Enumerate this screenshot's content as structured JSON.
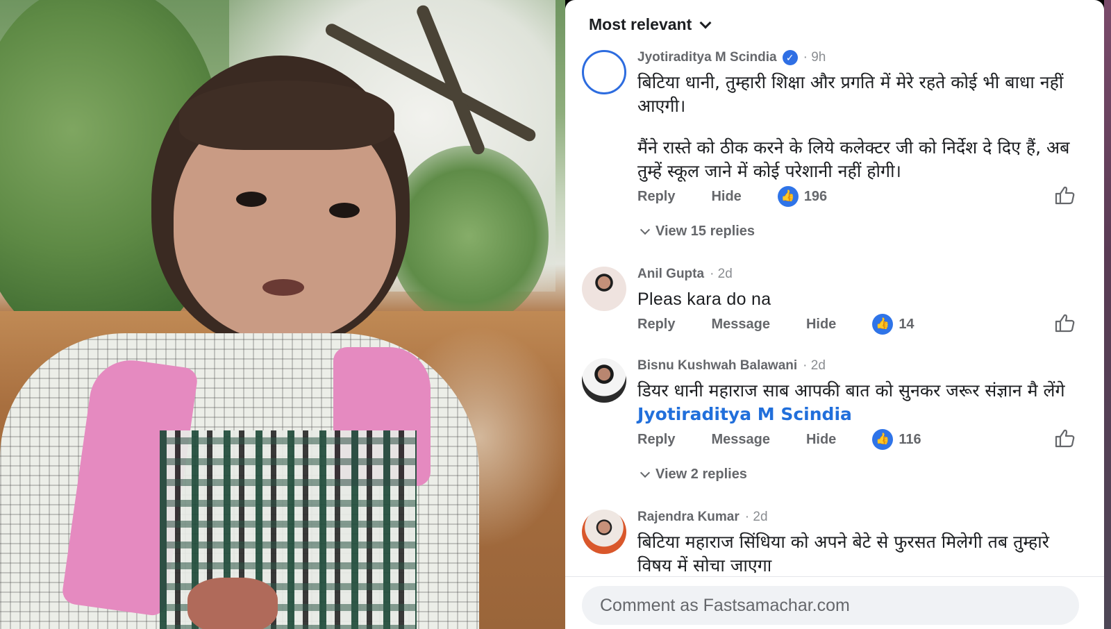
{
  "panel": {
    "sort_label": "Most relevant",
    "composer_placeholder": "Comment as Fastsamachar.com"
  },
  "comments": [
    {
      "name": "Jyotiraditya M Scindia",
      "verified": true,
      "time": "· 9h",
      "text_p1": "बिटिया धानी, तुम्हारी शिक्षा और प्रगति में मेरे रहते कोई भी बाधा नहीं आएगी।",
      "text_p2": "मैंने रास्ते को ठीक करने के लिये कलेक्टर जी को निर्देश दे दिए हैं, अब तुम्हें स्कूल जाने में कोई परेशानी नहीं होगी।",
      "actions": [
        "Reply",
        "Hide"
      ],
      "likes": "196",
      "view_replies": "View 15 replies"
    },
    {
      "name": "Anil Gupta",
      "time": "· 2d",
      "text": "Pleas kara do na",
      "actions": [
        "Reply",
        "Message",
        "Hide"
      ],
      "likes": "14"
    },
    {
      "name": "Bisnu Kushwah Balawani",
      "time": "· 2d",
      "text": "डियर धानी महाराज साब आपकी बात को सुनकर जरूर संज्ञान मै लेंगे",
      "mention": "Jyotiraditya M Scindia",
      "actions": [
        "Reply",
        "Message",
        "Hide"
      ],
      "likes": "116",
      "view_replies": "View 2 replies"
    },
    {
      "name": "Rajendra Kumar",
      "time": "· 2d",
      "text": "बिटिया महाराज सिंधिया को अपने बेटे से फुरसत मिलेगी तब तुम्हारे विषय में सोचा जाएगा"
    }
  ],
  "icons": {
    "like_bubble": "thumbs-up-icon",
    "like_button": "thumbs-up-outline-icon",
    "verified": "verified-badge-icon",
    "chevron": "chevron-down-icon"
  },
  "colors": {
    "link": "#216fdb",
    "like": "#2f74e8",
    "muted_text": "#65676b"
  }
}
